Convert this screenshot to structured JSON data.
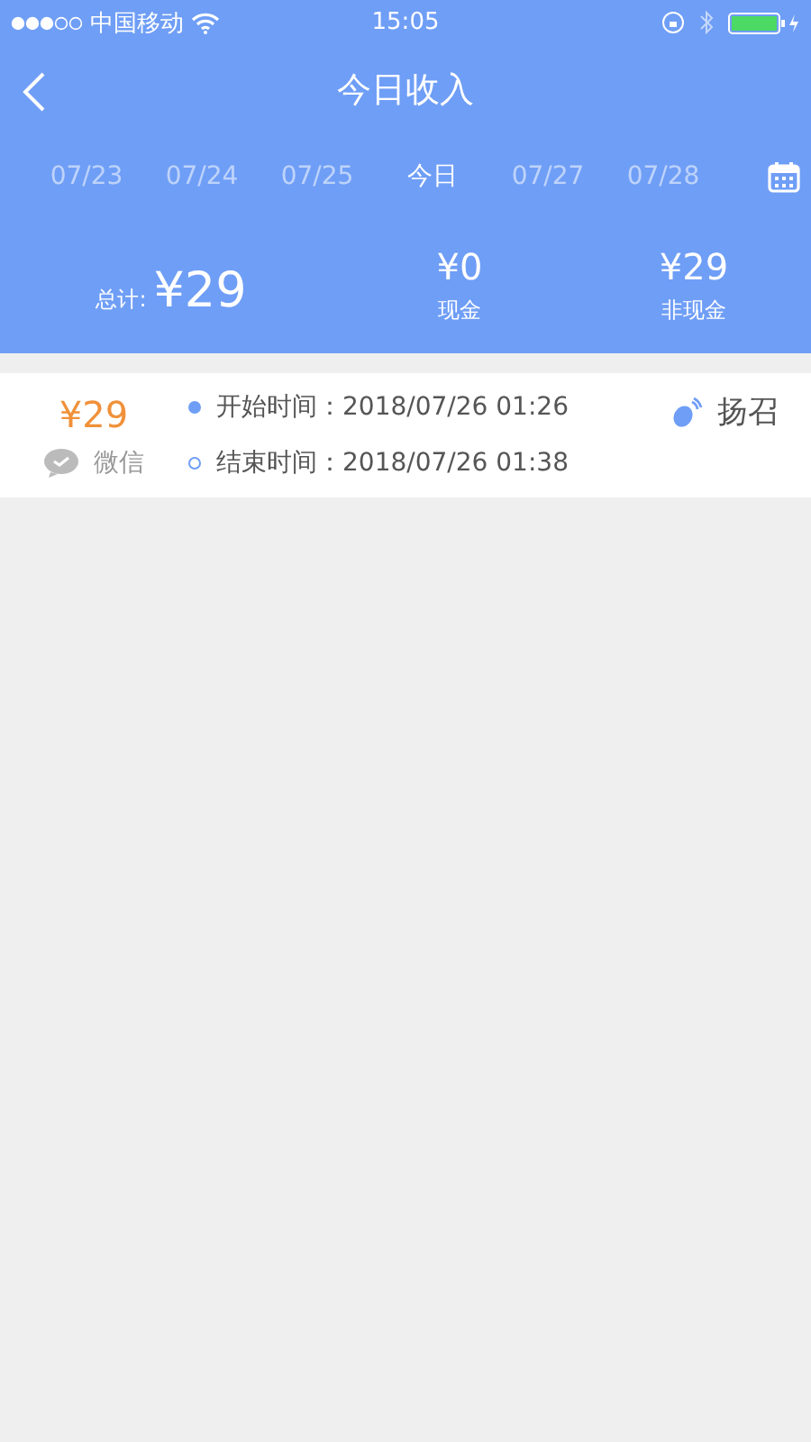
{
  "status_bar": {
    "carrier": "中国移动",
    "time": "15:05"
  },
  "nav": {
    "title": "今日收入"
  },
  "dates": [
    {
      "label": "07/23",
      "selected": false
    },
    {
      "label": "07/24",
      "selected": false
    },
    {
      "label": "07/25",
      "selected": false
    },
    {
      "label": "今日",
      "selected": true
    },
    {
      "label": "07/27",
      "selected": false
    },
    {
      "label": "07/28",
      "selected": false
    }
  ],
  "summary": {
    "total_label": "总计:",
    "total": "¥29",
    "cash": {
      "amount": "¥0",
      "label": "现金"
    },
    "non_cash": {
      "amount": "¥29",
      "label": "非现金"
    }
  },
  "orders": [
    {
      "amount": "¥29",
      "payment": "微信",
      "start": "开始时间：2018/07/26 01:26",
      "end": "结束时间：2018/07/26 01:38",
      "type": "扬召"
    }
  ]
}
